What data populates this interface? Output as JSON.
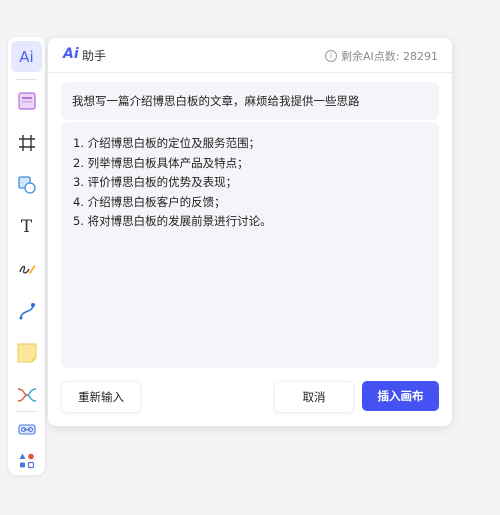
{
  "toolbar": {
    "ai_label": "Ai",
    "tools": [
      {
        "name": "ai-assistant-tool",
        "icon": "ai-icon",
        "active": true
      },
      {
        "name": "template-tool",
        "icon": "template-icon"
      },
      {
        "name": "frame-tool",
        "icon": "frame-icon"
      },
      {
        "name": "shape-tool",
        "icon": "shape-icon"
      },
      {
        "name": "text-tool",
        "icon": "text-icon"
      },
      {
        "name": "pen-tool",
        "icon": "pen-icon"
      },
      {
        "name": "connector-tool",
        "icon": "connector-icon"
      },
      {
        "name": "sticky-note-tool",
        "icon": "sticky-note-icon"
      },
      {
        "name": "mindmap-tool",
        "icon": "mindmap-icon"
      },
      {
        "name": "link-tool",
        "icon": "link-icon"
      },
      {
        "name": "more-tools",
        "icon": "apps-icon"
      }
    ],
    "text_tool_glyph": "T",
    "more_dots": "···"
  },
  "panel": {
    "logo": "Ai",
    "title": "助手",
    "credits": "剩余AI点数: 28291",
    "prompt": "我想写一篇介绍博思白板的文章，麻烦给我提供一些思路",
    "result_lines": [
      "1. 介绍博思白板的定位及服务范围；",
      "2. 列举博思白板具体产品及特点；",
      "3. 评价博思白板的优势及表现；",
      "4. 介绍博思白板客户的反馈；",
      "5. 将对博思白板的发展前景进行讨论。"
    ],
    "buttons": {
      "reinput": "重新输入",
      "cancel": "取消",
      "insert": "插入画布"
    }
  },
  "colors": {
    "accent": "#4352f0",
    "sticky": "#fbe69a"
  }
}
